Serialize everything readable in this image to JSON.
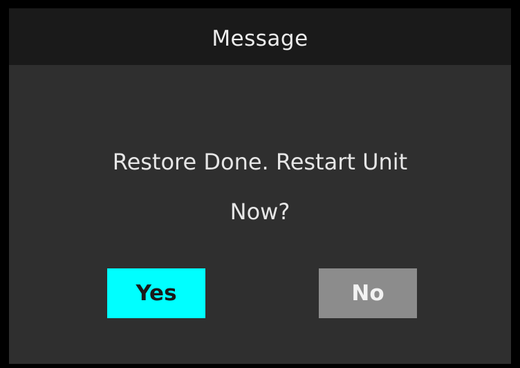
{
  "dialog": {
    "title": "Message",
    "message_line1": "Restore Done. Restart Unit",
    "message_line2": "Now?"
  },
  "buttons": {
    "yes_label": "Yes",
    "no_label": "No"
  },
  "colors": {
    "frame": "#000000",
    "title_bar": "#1a1a1a",
    "body": "#2f2f2f",
    "yes_highlight": "#00ffff",
    "no_button": "#8c8c8c"
  }
}
